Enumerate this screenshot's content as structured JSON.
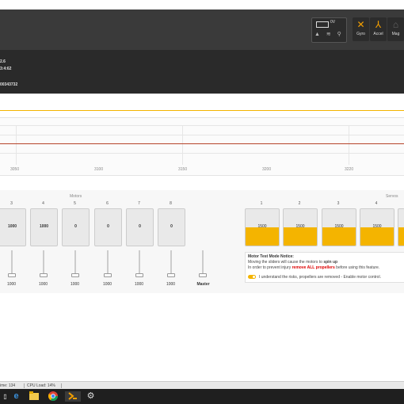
{
  "header": {
    "battery_voltage": "0V",
    "sensors": [
      {
        "name": "gyro-sensor",
        "label": "Gyro",
        "glyph": "✕",
        "color": "#f5a000"
      },
      {
        "name": "accel-sensor",
        "label": "Accel",
        "glyph": "⅄",
        "color": "#f5a000"
      },
      {
        "name": "mag-sensor",
        "label": "Mag",
        "glyph": "⌂",
        "color": "#666666"
      }
    ]
  },
  "info": {
    "line1": "2.6",
    "line2": "3:4:62",
    "line3": "00343732"
  },
  "graph": {
    "ticks": [
      "3050",
      "3100",
      "3150",
      "3200",
      "3220"
    ]
  },
  "motors": {
    "header": "Motors",
    "numbers": [
      "3",
      "4",
      "5",
      "6",
      "7",
      "8"
    ],
    "values": [
      "1000",
      "1000",
      "0",
      "0",
      "0",
      "0"
    ],
    "slider_values": [
      "1000",
      "1000",
      "1000",
      "1000",
      "1000",
      "1000"
    ],
    "master_label": "Master"
  },
  "servos": {
    "header": "Servos",
    "numbers": [
      "1",
      "2",
      "3",
      "4"
    ],
    "values": [
      "1500",
      "1500",
      "1500",
      "1500"
    ]
  },
  "notice": {
    "title": "Motor Test Mode Notice:",
    "line1_a": "Moving the sliders will cause the motors to ",
    "line1_b": "spin up",
    "line2_a": "In order to prevent injury ",
    "line2_b": "remove ALL propellers",
    "line2_c": " before using this feature.",
    "toggle_label": "I understand the risks, propellers are removed - Enable motor control."
  },
  "status": {
    "cycle": "ime: 134",
    "cpu": "CPU Load: 14%"
  },
  "taskbar": {
    "icons": [
      "windows-icon",
      "edge-icon",
      "explorer-icon",
      "chrome-icon",
      "app-icon",
      "settings-icon"
    ]
  }
}
